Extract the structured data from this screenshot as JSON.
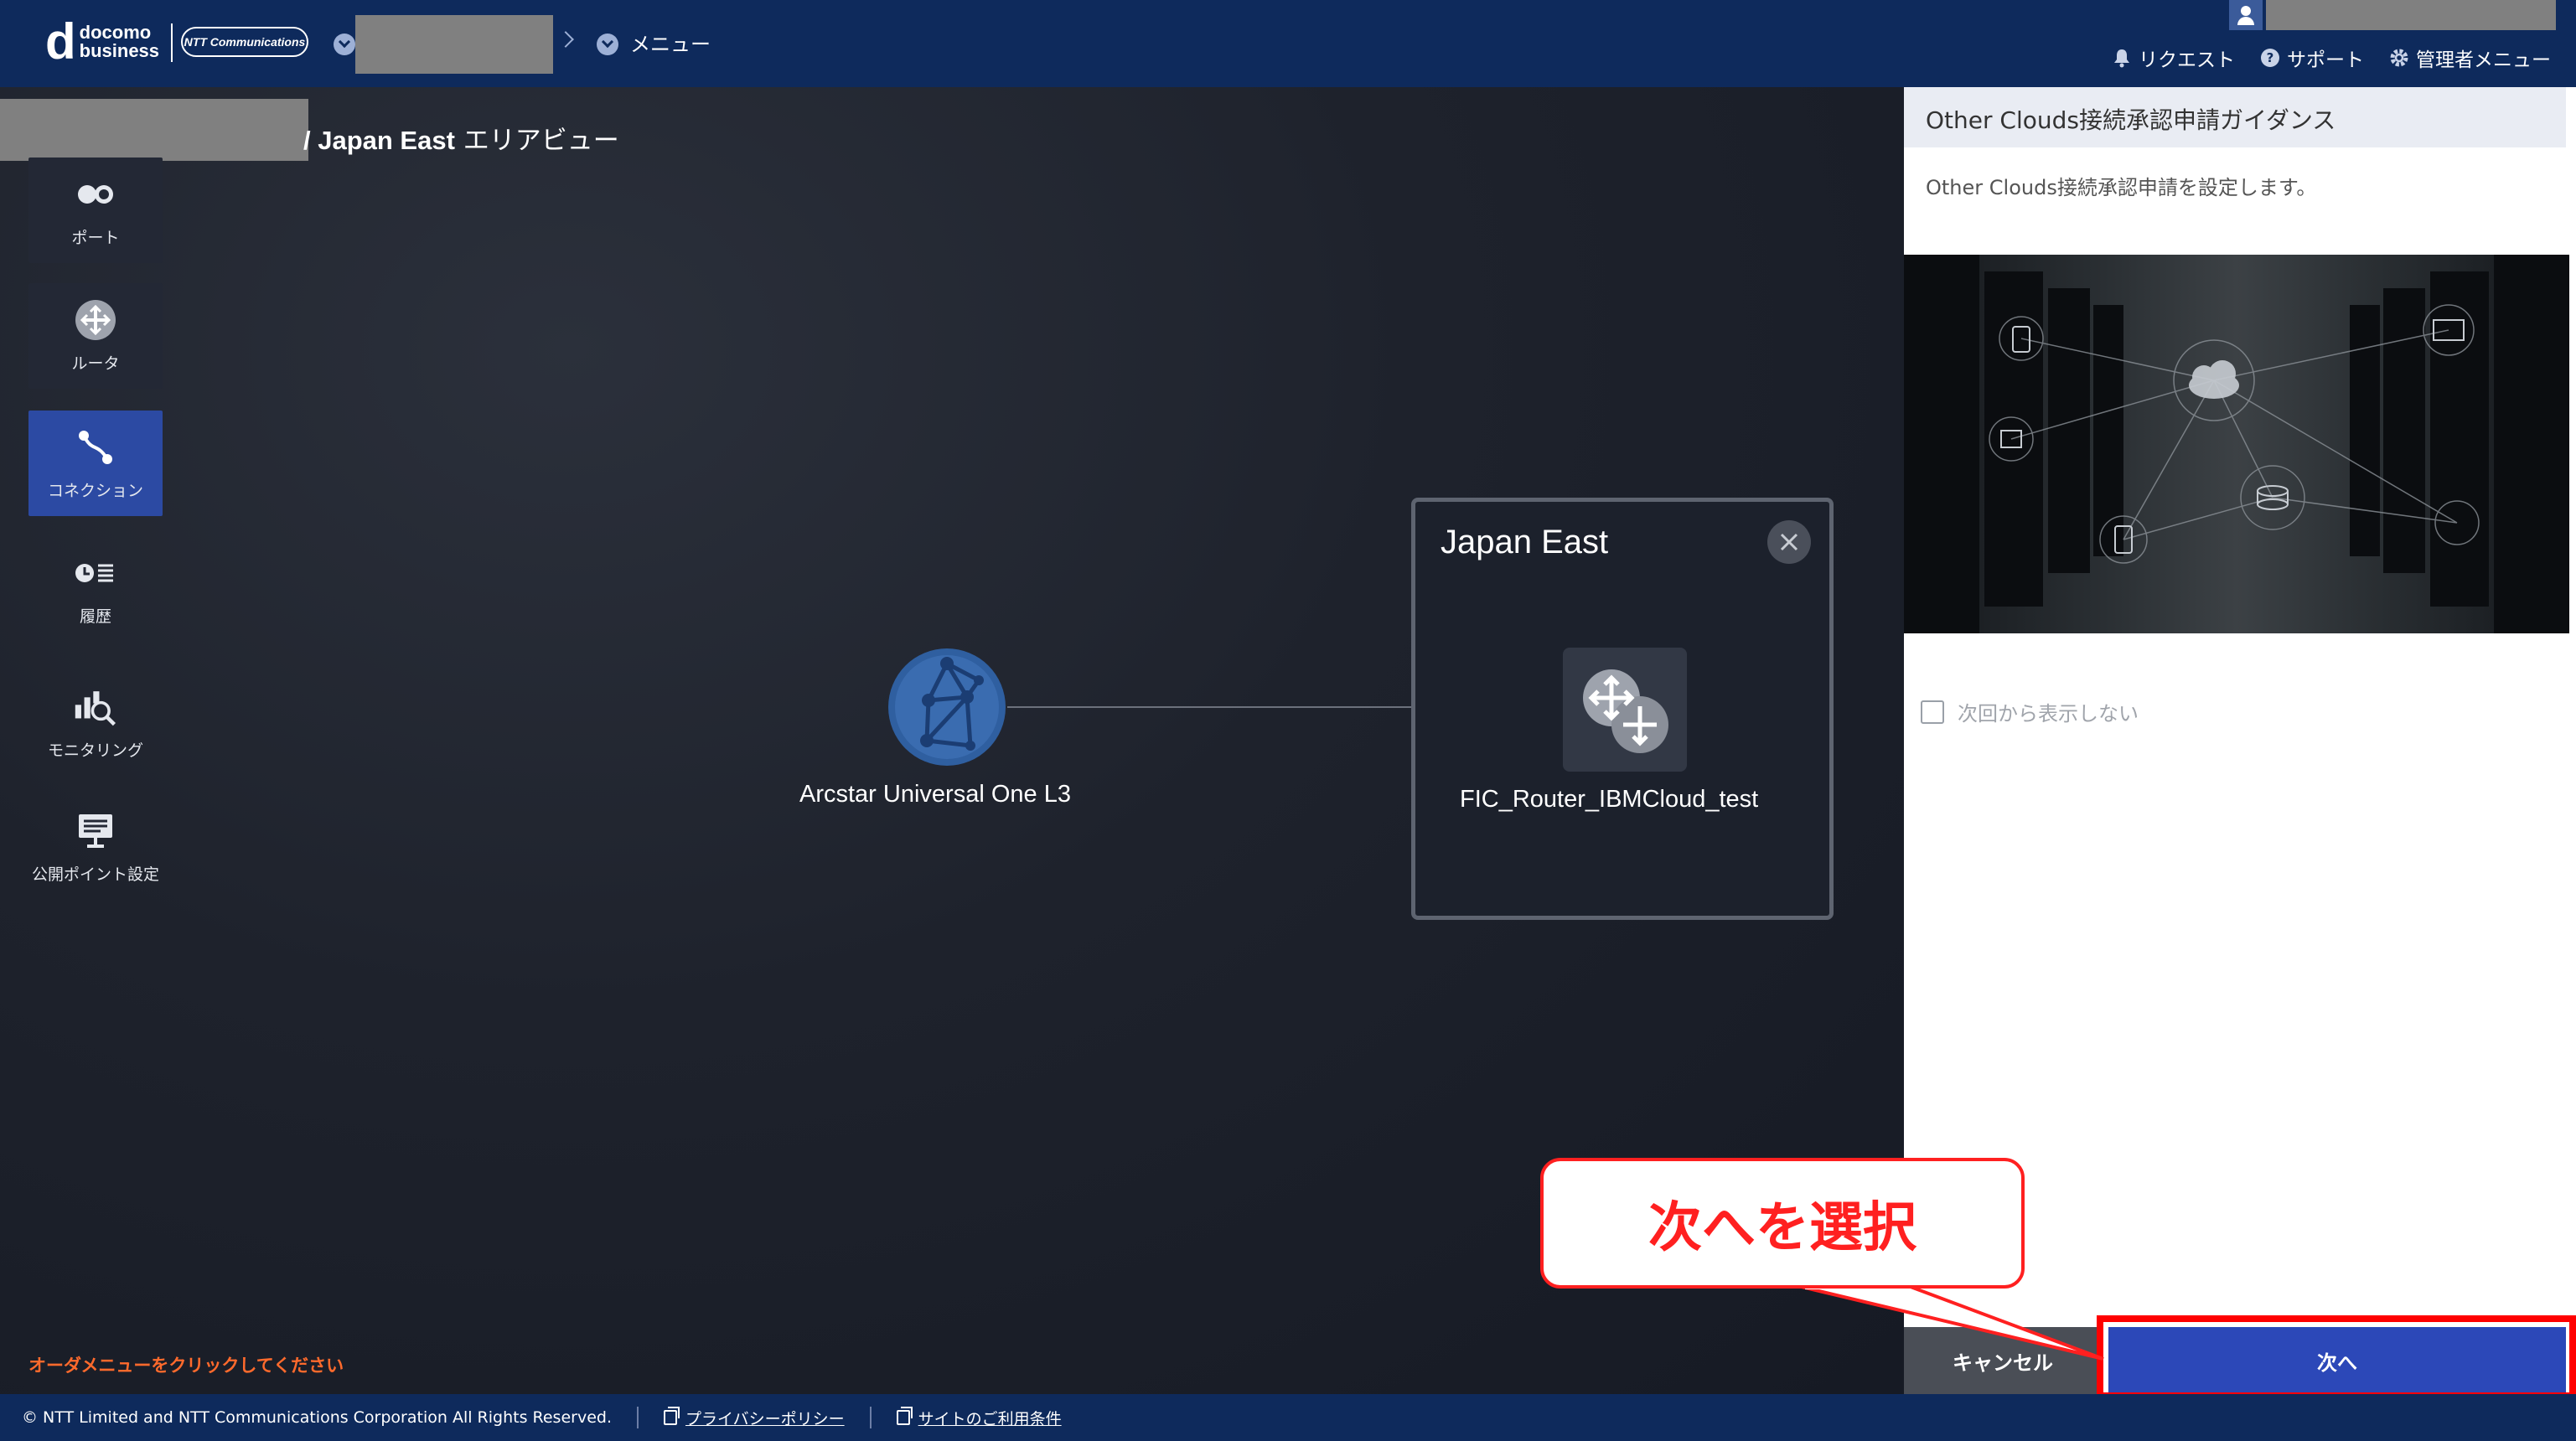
{
  "header": {
    "logo_main": "d",
    "logo_line1": "docomo",
    "logo_line2": "business",
    "logo_ntt": "NTT Communications",
    "breadcrumb_menu": "メニュー",
    "links": [
      {
        "label": "リクエスト",
        "icon": "bell-icon"
      },
      {
        "label": "サポート",
        "icon": "help-circle-icon"
      },
      {
        "label": "管理者メニュー",
        "icon": "gear-icon"
      }
    ]
  },
  "canvas": {
    "area_title_prefix": "/ Japan East",
    "area_title_suffix": " エリアビュー",
    "sidebar": [
      {
        "label": "ポート",
        "icon": "port-icon",
        "active": false
      },
      {
        "label": "ルータ",
        "icon": "router-icon",
        "active": false
      },
      {
        "label": "コネクション",
        "icon": "connection-icon",
        "active": true
      },
      {
        "label": "履歴",
        "icon": "history-icon",
        "active": false
      },
      {
        "label": "モニタリング",
        "icon": "monitoring-icon",
        "active": false
      },
      {
        "label": "公開ポイント設定",
        "icon": "public-point-icon",
        "active": false
      }
    ],
    "node_cloud_label": "Arcstar Universal One L3",
    "area_box_title": "Japan East",
    "router_label": "FIC_Router_IBMCloud_test",
    "order_hint": "オーダメニューをクリックしてください"
  },
  "panel": {
    "title": "Other Clouds接続承認申請ガイダンス",
    "description": "Other Clouds接続承認申請を設定します。",
    "checkbox_label": "次回から表示しない",
    "checkbox_checked": false,
    "cancel_label": "キャンセル",
    "next_label": "次へ"
  },
  "callout": {
    "text": "次へを選択"
  },
  "footer": {
    "copyright": "© NTT Limited and NTT Communications Corporation All Rights Reserved.",
    "privacy": "プライバシーポリシー",
    "terms": "サイトのご利用条件"
  },
  "colors": {
    "header_bg": "#0e2a5c",
    "active_tab": "#2c4aa3",
    "next_button": "#2c48b8",
    "highlight_red": "#ff0000",
    "order_hint": "#ff6a2c"
  }
}
